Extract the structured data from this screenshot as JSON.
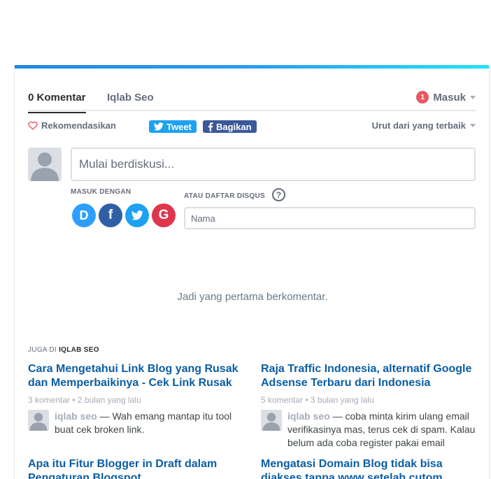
{
  "nav": {
    "comments_tab": "0 Komentar",
    "community_tab": "Iqlab Seo",
    "notification_count": "1",
    "login_label": "Masuk"
  },
  "toolbar": {
    "recommend_label": "Rekomendasikan",
    "tweet_label": "Tweet",
    "share_label": "Bagikan",
    "sort_label": "Urut dari yang terbaik"
  },
  "composer": {
    "placeholder": "Mulai berdiskusi...",
    "login_with_label": "MASUK DENGAN",
    "guest_label": "ATAU DAFTAR DISQUS",
    "help_glyph": "?",
    "name_placeholder": "Nama",
    "social": [
      {
        "name": "Disqus",
        "glyph": "D",
        "color": "#2e9fff"
      },
      {
        "name": "Facebook",
        "glyph": "f",
        "color": "#305fa5"
      },
      {
        "name": "Twitter",
        "glyph": "twitter-icon",
        "color": "#1da1f2"
      },
      {
        "name": "Google",
        "glyph": "G",
        "color": "#e0364d"
      }
    ]
  },
  "empty_message": "Jadi yang pertama berkomentar.",
  "also_on": {
    "prefix": "JUGA DI",
    "site": "IQLAB SEO",
    "items": [
      {
        "title": "Cara Mengetahui Link Blog yang Rusak dan Memperbaikinya - Cek Link Rusak",
        "meta": "3 komentar • 2 bulan yang lalu",
        "author": "iqlab seo",
        "comment": " — Wah emang mantap itu tool buat cek broken link."
      },
      {
        "title": "Raja Traffic Indonesia, alternatif Google Adsense Terbaru dari Indonesia",
        "meta": "5 komentar • 3 bulan yang lalu",
        "author": "iqlab seo",
        "comment": " — coba minta kirim ulang email verifikasinya mas, terus cek di spam. Kalau belum ada coba register pakai email"
      },
      {
        "title": "Apa itu Fitur Blogger in Draft dalam Pengaturan Blogspot",
        "meta": "",
        "author": "",
        "comment": ""
      },
      {
        "title": "Mengatasi Domain Blog tidak bisa diakses tanpa www setelah cutom",
        "meta": "",
        "author": "",
        "comment": ""
      }
    ]
  },
  "colors": {
    "accent": "#1e88e5",
    "link": "#0b5ea3",
    "notification": "#e65a65"
  }
}
